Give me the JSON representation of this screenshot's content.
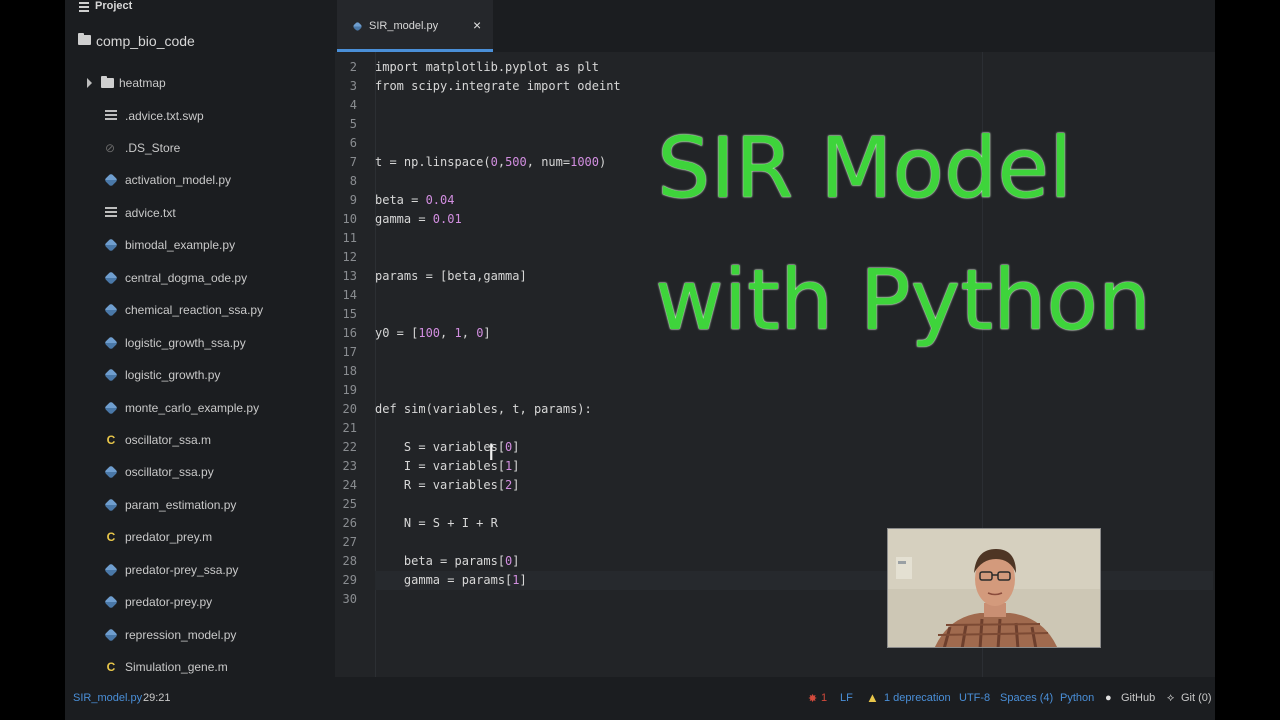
{
  "sidebar": {
    "header": "Project",
    "root": "comp_bio_code",
    "items": [
      {
        "name": "heatmap",
        "icon": "folder-icon"
      },
      {
        "name": ".advice.txt.swp",
        "icon": "text-file-icon"
      },
      {
        "name": ".DS_Store",
        "icon": "hidden-file-icon"
      },
      {
        "name": "activation_model.py",
        "icon": "python-icon"
      },
      {
        "name": "advice.txt",
        "icon": "text-file-icon"
      },
      {
        "name": "bimodal_example.py",
        "icon": "python-icon"
      },
      {
        "name": "central_dogma_ode.py",
        "icon": "python-icon"
      },
      {
        "name": "chemical_reaction_ssa.py",
        "icon": "python-icon"
      },
      {
        "name": "logistic_growth_ssa.py",
        "icon": "python-icon"
      },
      {
        "name": "logistic_growth.py",
        "icon": "python-icon"
      },
      {
        "name": "monte_carlo_example.py",
        "icon": "python-icon"
      },
      {
        "name": "oscillator_ssa.m",
        "icon": "matlab-icon"
      },
      {
        "name": "oscillator_ssa.py",
        "icon": "python-icon"
      },
      {
        "name": "param_estimation.py",
        "icon": "python-icon"
      },
      {
        "name": "predator_prey.m",
        "icon": "matlab-icon"
      },
      {
        "name": "predator-prey_ssa.py",
        "icon": "python-icon"
      },
      {
        "name": "predator-prey.py",
        "icon": "python-icon"
      },
      {
        "name": "repression_model.py",
        "icon": "python-icon"
      },
      {
        "name": "Simulation_gene.m",
        "icon": "matlab-icon"
      }
    ]
  },
  "tab": {
    "title": "SIR_model.py",
    "close": "×"
  },
  "editor": {
    "lines": [
      {
        "n": "2",
        "text": "import matplotlib.pyplot as plt"
      },
      {
        "n": "3",
        "text": "from scipy.integrate import odeint"
      },
      {
        "n": "4",
        "text": ""
      },
      {
        "n": "5",
        "text": ""
      },
      {
        "n": "6",
        "text": ""
      },
      {
        "n": "7",
        "text": "t = np.linspace(0,500, num=1000)"
      },
      {
        "n": "8",
        "text": ""
      },
      {
        "n": "9",
        "text": "beta = 0.04"
      },
      {
        "n": "10",
        "text": "gamma = 0.01"
      },
      {
        "n": "11",
        "text": ""
      },
      {
        "n": "12",
        "text": ""
      },
      {
        "n": "13",
        "text": "params = [beta,gamma]"
      },
      {
        "n": "14",
        "text": ""
      },
      {
        "n": "15",
        "text": ""
      },
      {
        "n": "16",
        "text": "y0 = [100, 1, 0]"
      },
      {
        "n": "17",
        "text": ""
      },
      {
        "n": "18",
        "text": ""
      },
      {
        "n": "19",
        "text": ""
      },
      {
        "n": "20",
        "text": "def sim(variables, t, params):"
      },
      {
        "n": "21",
        "text": ""
      },
      {
        "n": "22",
        "text": "    S = variables[0]"
      },
      {
        "n": "23",
        "text": "    I = variables[1]"
      },
      {
        "n": "24",
        "text": "    R = variables[2]"
      },
      {
        "n": "25",
        "text": ""
      },
      {
        "n": "26",
        "text": "    N = S + I + R"
      },
      {
        "n": "27",
        "text": ""
      },
      {
        "n": "28",
        "text": "    beta = params[0]"
      },
      {
        "n": "29",
        "text": "    gamma = params[1]"
      },
      {
        "n": "30",
        "text": ""
      }
    ]
  },
  "overlay": {
    "line1": "SIR Model",
    "line2": "with Python"
  },
  "statusbar": {
    "file": "SIR_model.py",
    "position": "29:21",
    "bugs": "1",
    "line_ending": "LF",
    "deprecation": "1 deprecation",
    "encoding": "UTF-8",
    "indent": "Spaces (4)",
    "grammar": "Python",
    "github": "GitHub",
    "git": "Git (0)"
  },
  "colors": {
    "accent": "#4a8fd8",
    "overlay_text": "#3ed43b",
    "number": "#d28ee0"
  }
}
